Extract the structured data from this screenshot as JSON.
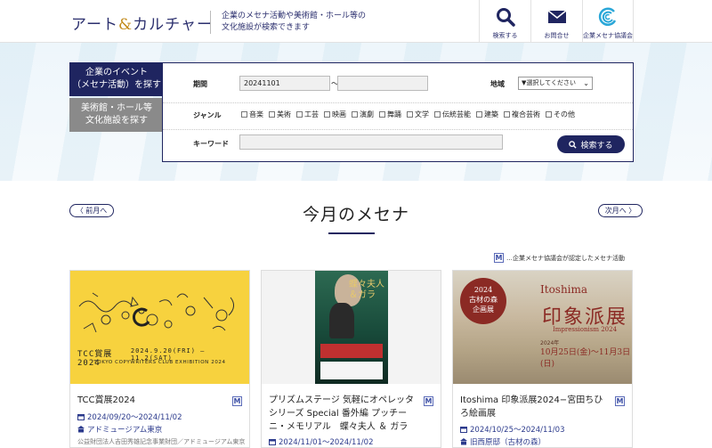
{
  "header": {
    "logo_main": "アート",
    "logo_amp": "&",
    "logo_sub": "カルチャー",
    "tagline_line1": "企業のメセナ活動や美術館・ホール等の",
    "tagline_line2": "文化施設が検索できます",
    "nav": [
      {
        "label": "検索する",
        "icon": "search-icon"
      },
      {
        "label": "お問合せ",
        "icon": "mail-icon"
      },
      {
        "label": "企業メセナ協議会",
        "icon": "mecenat-logo-icon"
      }
    ]
  },
  "search": {
    "tab_active_line1": "企業のイベント",
    "tab_active_line2": "（メセナ活動）を探す",
    "tab_inactive_line1": "美術館・ホール等",
    "tab_inactive_line2": "文化施設を探す",
    "period_label": "期間",
    "date_from": "20241101",
    "date_to": "",
    "tilde": "〜",
    "region_label": "地域",
    "region_selected": "▼選択してください",
    "genre_label": "ジャンル",
    "genres": [
      "音楽",
      "美術",
      "工芸",
      "映画",
      "演劇",
      "舞踊",
      "文学",
      "伝統芸能",
      "建築",
      "複合芸術",
      "その他"
    ],
    "keyword_label": "キーワード",
    "keyword_value": "",
    "search_button": "検索する"
  },
  "month": {
    "title": "今月のメセナ",
    "prev": "〈 前月へ",
    "next": "次月へ 〉",
    "legend_text": "…企業メセナ協議会が認定したメセナ活動",
    "legend_icon": "M"
  },
  "cards": [
    {
      "title": "TCC賞展2024",
      "date": "2024/09/20〜2024/11/02",
      "venue": "アドミュージアム東京",
      "org": "公益財団法人吉田秀雄記念事業財団／アドミュージアム東京",
      "image_text_main": "TCC賞展2024",
      "image_text_date": "2024.9.20(FRI) – 11.2(SAT)",
      "image_text_sub": "TOKYO COPYWRITERS CLUB EXHIBITION 2024"
    },
    {
      "title": "プリズムステージ 気軽にオペレッタシリーズ Special 番外編 プッチーニ・メモリアル　蝶々夫人 ＆ ガラ",
      "date": "2024/11/01〜2024/11/02",
      "venue": "",
      "org": "",
      "image_text_main": "蝶々夫人＆ガラ"
    },
    {
      "title": "Itoshima 印象派展2024−宮田ちひろ絵画展",
      "date": "2024/10/25〜2024/11/03",
      "venue": "旧西原邸（古材の森）",
      "org": "",
      "image_badge_line1": "2024",
      "image_badge_line2": "古材の森",
      "image_badge_line3": "企画展",
      "image_head": "Itoshima",
      "image_title": "印象派展",
      "image_sub": "Impressionism 2024",
      "image_dates": "10月25日(金)〜11月3日(日)",
      "image_year": "2024年"
    }
  ],
  "colors": {
    "navy": "#1f2560",
    "gray_tab": "#8a8a8a",
    "tcc_yellow": "#f7d23e"
  }
}
